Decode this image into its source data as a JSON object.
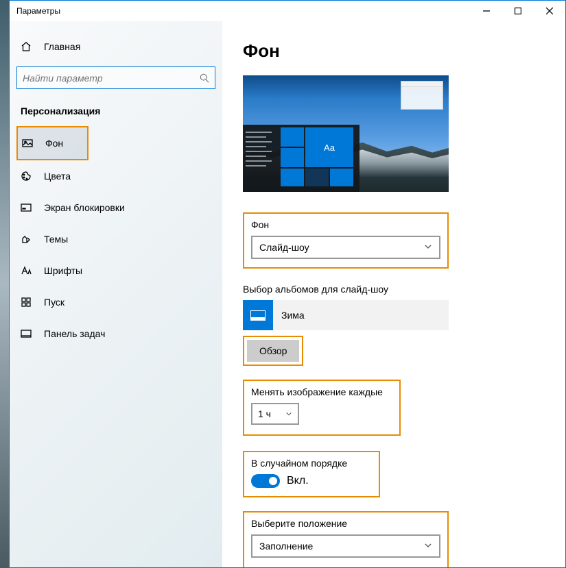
{
  "window": {
    "title": "Параметры"
  },
  "home": {
    "label": "Главная"
  },
  "search": {
    "placeholder": "Найти параметр"
  },
  "category": {
    "title": "Персонализация"
  },
  "nav": {
    "items": [
      {
        "label": "Фон"
      },
      {
        "label": "Цвета"
      },
      {
        "label": "Экран блокировки"
      },
      {
        "label": "Темы"
      },
      {
        "label": "Шрифты"
      },
      {
        "label": "Пуск"
      },
      {
        "label": "Панель задач"
      }
    ]
  },
  "page": {
    "title": "Фон"
  },
  "preview": {
    "tile_label": "Aa"
  },
  "background": {
    "label": "Фон",
    "value": "Слайд-шоу"
  },
  "album": {
    "label": "Выбор альбомов для слайд-шоу",
    "name": "Зима",
    "browse": "Обзор"
  },
  "interval": {
    "label": "Менять изображение каждые",
    "value": "1 ч"
  },
  "shuffle": {
    "label": "В случайном порядке",
    "state": "Вкл."
  },
  "fit": {
    "label": "Выберите положение",
    "value": "Заполнение"
  }
}
